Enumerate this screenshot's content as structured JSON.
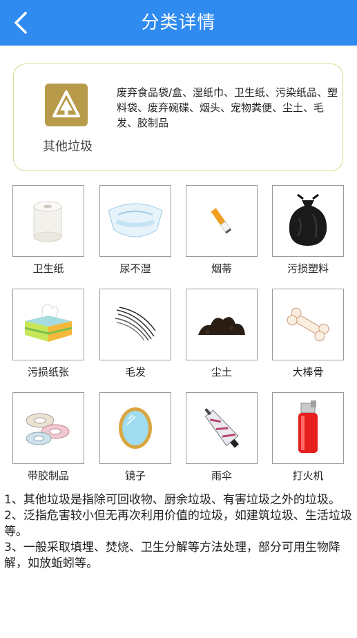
{
  "header": {
    "title": "分类详情",
    "back_icon": "chevron-left-icon"
  },
  "category": {
    "name": "其他垃圾",
    "icon": "other-waste-logo",
    "description": "废弃食品袋/盒、湿纸巾、卫生纸、污染纸品、塑料袋、废弃碗碟、烟头、宠物粪便、尘土、毛发、胶制品",
    "accent_color": "#b79b4a"
  },
  "items": [
    {
      "label": "卫生纸"
    },
    {
      "label": "尿不湿"
    },
    {
      "label": "烟蒂"
    },
    {
      "label": "污损塑料"
    },
    {
      "label": "污损纸张"
    },
    {
      "label": "毛发"
    },
    {
      "label": "尘土"
    },
    {
      "label": "大棒骨"
    },
    {
      "label": "带胶制品"
    },
    {
      "label": "镜子"
    },
    {
      "label": "雨伞"
    },
    {
      "label": "打火机"
    }
  ],
  "notes": [
    "1、其他垃圾是指除可回收物、厨余垃圾、有害垃圾之外的垃圾。",
    "2、泛指危害较小但无再次利用价值的垃圾，如建筑垃圾、生活垃圾等。",
    "3、一般采取填埋、焚烧、卫生分解等方法处理，部分可用生物降解，如放蚯蚓等。"
  ]
}
